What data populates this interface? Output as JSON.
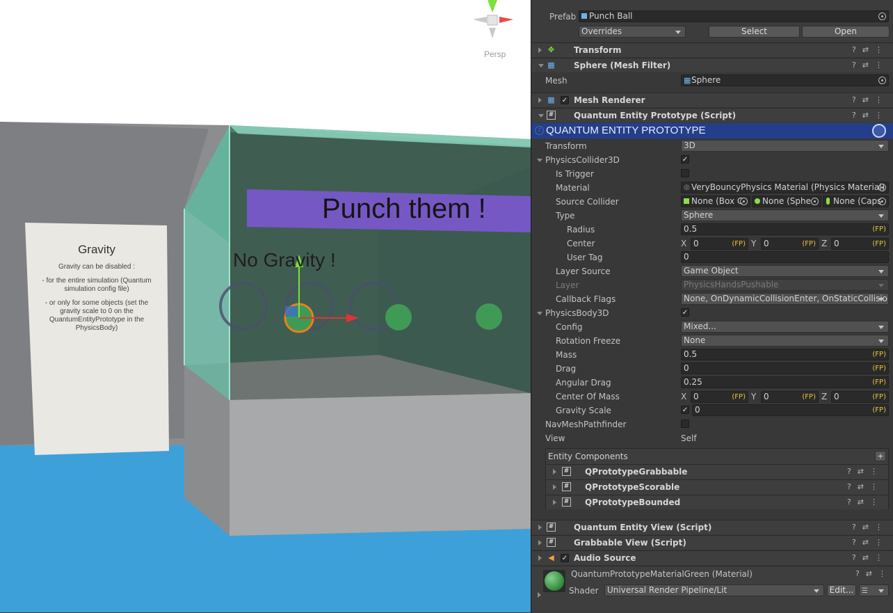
{
  "scene": {
    "gizmo_label": "Persp",
    "banner_text": "Punch them !",
    "no_gravity_text": "No Gravity !",
    "sign": {
      "title": "Gravity",
      "line1": "Gravity can be disabled :",
      "line2a": "- for the entire simulation (Quantum",
      "line2b": "simulation config file)",
      "line3a": "- or only for some objects (set the",
      "line3b": "gravity scale to 0 on the",
      "line3c": "QuantumEntityPrototype in the",
      "line3d": "PhysicsBody)"
    }
  },
  "inspector": {
    "prefab_label": "Prefab",
    "prefab_value": "Punch Ball",
    "overrides_label": "Overrides",
    "select_label": "Select",
    "open_label": "Open",
    "components": {
      "transform": "Transform",
      "mesh_filter": "Sphere (Mesh Filter)",
      "mesh_renderer": "Mesh Renderer",
      "qep_script": "Quantum Entity Prototype (Script)",
      "quantum_entity_view": "Quantum Entity View (Script)",
      "grabbable_view": "Grabbable View (Script)",
      "audio_source": "Audio Source"
    },
    "mesh": {
      "label": "Mesh",
      "value": "Sphere"
    },
    "qep_banner": "QUANTUM ENTITY PROTOTYPE",
    "fp": "(FP)",
    "transform_row": {
      "label": "Transform",
      "value": "3D"
    },
    "collider": {
      "label": "PhysicsCollider3D",
      "is_trigger": "Is Trigger",
      "material_label": "Material",
      "material_value": "VeryBouncyPhysics Material (Physics Material)",
      "source_collider_label": "Source Collider",
      "source_box": "None (Box C",
      "source_sphere": "None (Sphe",
      "source_capsule": "None (Caps",
      "type_label": "Type",
      "type_value": "Sphere",
      "radius_label": "Radius",
      "radius_value": "0.5",
      "center_label": "Center",
      "center_x": "0",
      "center_y": "0",
      "center_z": "0",
      "user_tag_label": "User Tag",
      "user_tag_value": "0",
      "layer_source_label": "Layer Source",
      "layer_source_value": "Game Object",
      "layer_label": "Layer",
      "layer_value": "PhysicsHandsPushable",
      "callback_label": "Callback Flags",
      "callback_value": "None, OnDynamicCollisionEnter, OnStaticCollision"
    },
    "body": {
      "label": "PhysicsBody3D",
      "config_label": "Config",
      "config_value": "Mixed...",
      "rotation_label": "Rotation Freeze",
      "rotation_value": "None",
      "mass_label": "Mass",
      "mass_value": "0.5",
      "drag_label": "Drag",
      "drag_value": "0",
      "angular_drag_label": "Angular Drag",
      "angular_drag_value": "0.25",
      "com_label": "Center Of Mass",
      "com_x": "0",
      "com_y": "0",
      "com_z": "0",
      "gravity_label": "Gravity Scale",
      "gravity_value": "0"
    },
    "navmesh_label": "NavMeshPathfinder",
    "view_label": "View",
    "view_value": "Self",
    "entity_components": {
      "title": "Entity Components",
      "add": "+",
      "items": [
        "QPrototypeGrabbable",
        "QPrototypeScorable",
        "QPrototypeBounded"
      ]
    },
    "material": {
      "name": "QuantumPrototypeMaterialGreen (Material)",
      "shader_label": "Shader",
      "shader_value": "Universal Render Pipeline/Lit",
      "edit_label": "Edit..."
    },
    "axis": {
      "x": "X",
      "y": "Y",
      "z": "Z"
    }
  }
}
